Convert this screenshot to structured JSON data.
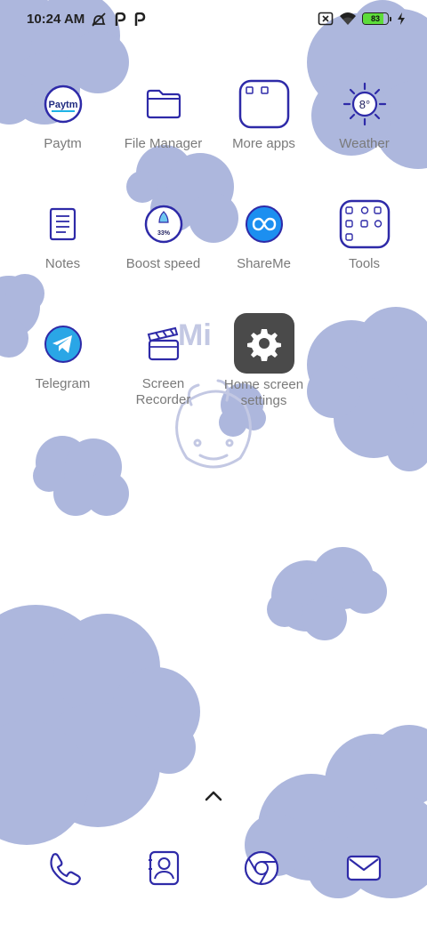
{
  "status_bar": {
    "time": "10:24 AM",
    "notification_icons": [
      "alarm-off-icon",
      "paytm-p-icon",
      "paytm-p-icon"
    ],
    "system_icons": [
      "sim-off-icon",
      "wifi-icon",
      "battery-icon",
      "charging-icon"
    ],
    "battery_level": "83",
    "battery_fraction": 0.83,
    "battery_color": "#5ddc3a"
  },
  "wallpaper": {
    "cloud_color": "#adb7dd",
    "outline_color": "#2e2aa8",
    "watermark_text": "Mi"
  },
  "apps": [
    {
      "name": "Paytm",
      "icon": "paytm-icon",
      "brand_text": "Paytm"
    },
    {
      "name": "File Manager",
      "icon": "folder-icon"
    },
    {
      "name": "More apps",
      "icon": "app-folder-icon"
    },
    {
      "name": "Weather",
      "icon": "sun-icon",
      "temperature": "8°"
    },
    {
      "name": "Notes",
      "icon": "notes-icon"
    },
    {
      "name": "Boost speed",
      "icon": "rocket-icon",
      "percent": "33%"
    },
    {
      "name": "ShareMe",
      "icon": "infinity-icon"
    },
    {
      "name": "Tools",
      "icon": "tools-folder-icon"
    },
    {
      "name": "Telegram",
      "icon": "paper-plane-icon"
    },
    {
      "name": "Screen Recorder",
      "icon": "clapperboard-icon"
    },
    {
      "name": "Home screen settings",
      "icon": "gear-icon"
    }
  ],
  "drawer": {
    "icon": "chevron-up-icon"
  },
  "dock": [
    {
      "name": "Phone",
      "icon": "phone-icon"
    },
    {
      "name": "Contacts",
      "icon": "contacts-icon"
    },
    {
      "name": "Browser",
      "icon": "browser-icon"
    },
    {
      "name": "Messages",
      "icon": "mail-icon"
    }
  ]
}
